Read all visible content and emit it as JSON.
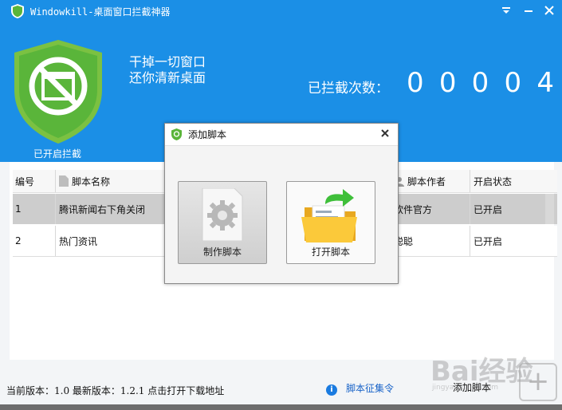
{
  "window": {
    "title": "Windowkill-桌面窗口拦截神器",
    "menu_icon": "chevron-down-icon",
    "minimize_icon": "minimize-icon",
    "close_icon": "close-icon"
  },
  "header": {
    "status_label": "已开启拦截",
    "slogan_line1": "干掉一切窗口",
    "slogan_line2": "还你清新桌面",
    "count_label": "已拦截次数：",
    "count_digits": [
      "0",
      "0",
      "0",
      "0",
      "4"
    ],
    "colors": {
      "header_bg": "#1b8fe6",
      "shield": "#5ab53a"
    }
  },
  "table": {
    "columns": {
      "id": "编号",
      "name": "脚本名称",
      "author": "脚本作者",
      "status": "开启状态"
    },
    "rows": [
      {
        "id": "1",
        "name": "腾讯新闻右下角关闭",
        "author": "软件官方",
        "status": "已开启"
      },
      {
        "id": "2",
        "name": "热门资讯",
        "author": "聪聪",
        "status": "已开启"
      }
    ]
  },
  "dialog": {
    "title": "添加脚本",
    "make_button": "制作脚本",
    "open_button": "打开脚本"
  },
  "footer": {
    "version_text": "当前版本：1.0 最新版本：1.2.1 点击打开下载地址",
    "info_icon": "i",
    "script_link": "脚本征集令",
    "add_script": "添加脚本"
  },
  "watermark": {
    "brand": "Bai经验",
    "url": "jingyan.baidu.com",
    "plus": "+"
  }
}
